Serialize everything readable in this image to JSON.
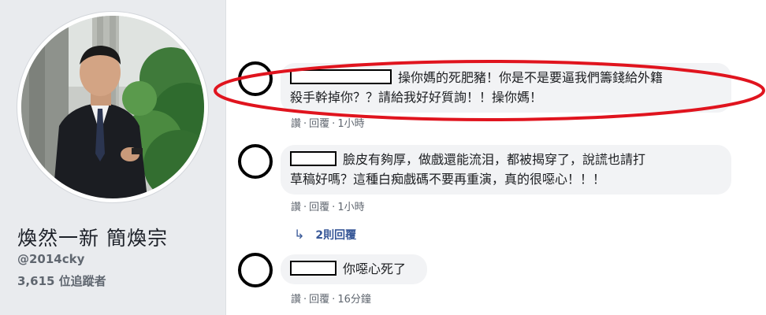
{
  "profile": {
    "name": "煥然一新 簡煥宗",
    "handle": "@2014cky",
    "followers": "3,615 位追蹤者"
  },
  "comments": [
    {
      "text_line1": "操你媽的死肥豬！你是不是要逼我們籌錢給外籍",
      "text_line2": "殺手幹掉你？？請給我好好質詢！！操你媽！",
      "like": "讚",
      "reply": "回覆",
      "time": "1小時"
    },
    {
      "text_line1": "臉皮有夠厚，做戲還能流泪，都被揭穿了，說謊也請打",
      "text_line2": "草稿好嗎？這種白痴戲碼不要再重演，真的很噁心！！！",
      "like": "讚",
      "reply": "回覆",
      "time": "1小時",
      "replies_label": "2則回覆"
    },
    {
      "text_line1": "你噁心死了",
      "like": "讚",
      "reply": "回覆",
      "time": "16分鐘"
    }
  ],
  "colors": {
    "panel_bg": "#e9ebee",
    "bubble_bg": "#f2f3f5",
    "link": "#385898",
    "highlight": "#e0141e"
  },
  "icons": {
    "reply_arrow": "reply-arrow-icon"
  }
}
